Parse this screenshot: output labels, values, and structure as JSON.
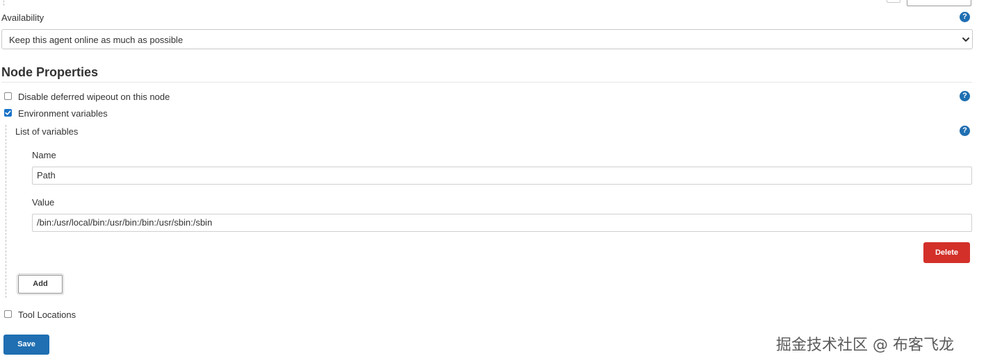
{
  "availability": {
    "label": "Availability",
    "selected": "Keep this agent online as much as possible"
  },
  "node_properties": {
    "heading": "Node Properties",
    "disable_deferred_wipeout": {
      "label": "Disable deferred wipeout on this node",
      "checked": false
    },
    "environment_variables": {
      "label": "Environment variables",
      "checked": true,
      "list_label": "List of variables",
      "name_label": "Name",
      "name_value": "Path",
      "value_label": "Value",
      "value_value": "/bin:/usr/local/bin:/usr/bin:/bin:/usr/sbin:/sbin",
      "delete_label": "Delete",
      "add_label": "Add"
    },
    "tool_locations": {
      "label": "Tool Locations",
      "checked": false
    }
  },
  "help_icon_glyph": "?",
  "save_label": "Save",
  "watermark": "掘金技术社区 @ 布客飞龙",
  "colors": {
    "accent_blue": "#1f6fb2",
    "checkbox_blue": "#1a73c8",
    "delete_red": "#d3302a",
    "text": "#333333"
  },
  "icons": {
    "help": "help-icon",
    "select_arrow": "chevron-down-icon",
    "checkbox_check": "check-icon"
  }
}
